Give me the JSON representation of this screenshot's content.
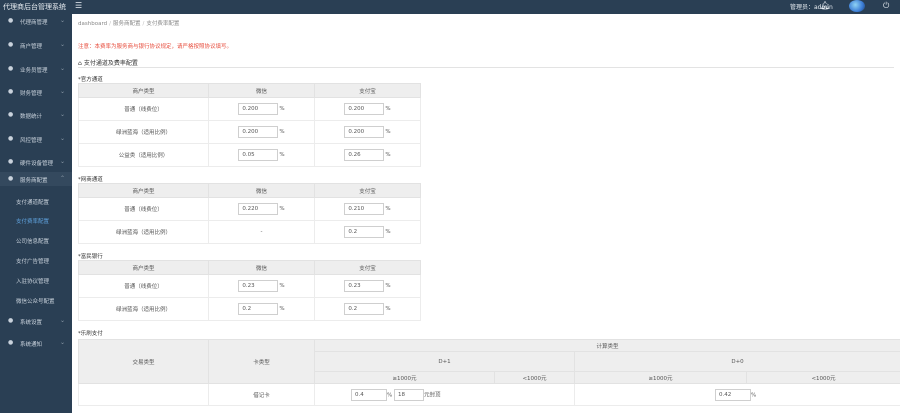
{
  "topbar": {
    "brand": "代理商后台管理系统",
    "menu_toggle": "☰",
    "admin_label": "管理员：admin",
    "bell_icon": "bell-icon",
    "power_icon": "power-icon"
  },
  "sidebar": {
    "items": [
      {
        "label": "代理商管理",
        "icon": "user-icon"
      },
      {
        "label": "商户管理",
        "icon": "users-icon"
      },
      {
        "label": "业务员管理",
        "icon": "person-icon"
      },
      {
        "label": "财务管理",
        "icon": "money-icon"
      },
      {
        "label": "数据统计",
        "icon": "chart-icon"
      },
      {
        "label": "风控管理",
        "icon": "shield-icon"
      },
      {
        "label": "硬件设备管理",
        "icon": "device-icon"
      },
      {
        "label": "服务商配置",
        "icon": "settings-icon"
      }
    ],
    "subitems": [
      {
        "label": "支付通道配置"
      },
      {
        "label": "支付费率配置"
      },
      {
        "label": "公司信息配置"
      },
      {
        "label": "支付广告管理"
      },
      {
        "label": "入驻协议管理"
      },
      {
        "label": "微信公众号配置"
      }
    ],
    "bottom_items": [
      {
        "label": "系统设置",
        "icon": "gear-icon"
      },
      {
        "label": "系统通知",
        "icon": "bell-icon"
      }
    ]
  },
  "breadcrumb": {
    "home": "dashboard",
    "parent": "服务商配置",
    "current": "支付费率配置"
  },
  "notice": "注意：本费率为服务商与银行协议规定，请严格按照协议填写。",
  "page_title": "支付通道及费率配置",
  "sections": [
    {
      "title": "*官方通道",
      "headers": [
        "商户类型",
        "微信",
        "支付宝"
      ],
      "rows": [
        {
          "type": "普通（线费位）",
          "wechat": "0.200",
          "alipay": "0.200"
        },
        {
          "type": "绿洲蓝海（适用比例）",
          "wechat": "0.200",
          "alipay": "0.200"
        },
        {
          "type": "公益类（适用比例）",
          "wechat": "0.05",
          "alipay": "0.26"
        }
      ]
    },
    {
      "title": "*网商通道",
      "headers": [
        "商户类型",
        "微信",
        "支付宝"
      ],
      "rows": [
        {
          "type": "普通（线费位）",
          "wechat": "0.220",
          "alipay": "0.210"
        },
        {
          "type": "绿洲蓝海（适用比例）",
          "wechat": "-",
          "alipay": "0.2"
        }
      ]
    },
    {
      "title": "*富民银行",
      "headers": [
        "商户类型",
        "微信",
        "支付宝"
      ],
      "rows": [
        {
          "type": "普通（线费位）",
          "wechat": "0.23",
          "alipay": "0.23"
        },
        {
          "type": "绿洲蓝海（适用比例）",
          "wechat": "0.2",
          "alipay": "0.2"
        }
      ]
    }
  ],
  "percent": "%",
  "big_table": {
    "title": "*乐刷支付",
    "col_trade": "交易类型",
    "col_card": "卡类型",
    "col_calc": "计算类型",
    "col_d1": "D+1",
    "col_d0": "D+0",
    "range_ge": "≥1000元",
    "range_lt": "<1000元",
    "row_card": "借记卡",
    "row_v1": "0.4",
    "row_v2": "18",
    "row_v3": "0.42",
    "cap_label": "元封顶"
  }
}
